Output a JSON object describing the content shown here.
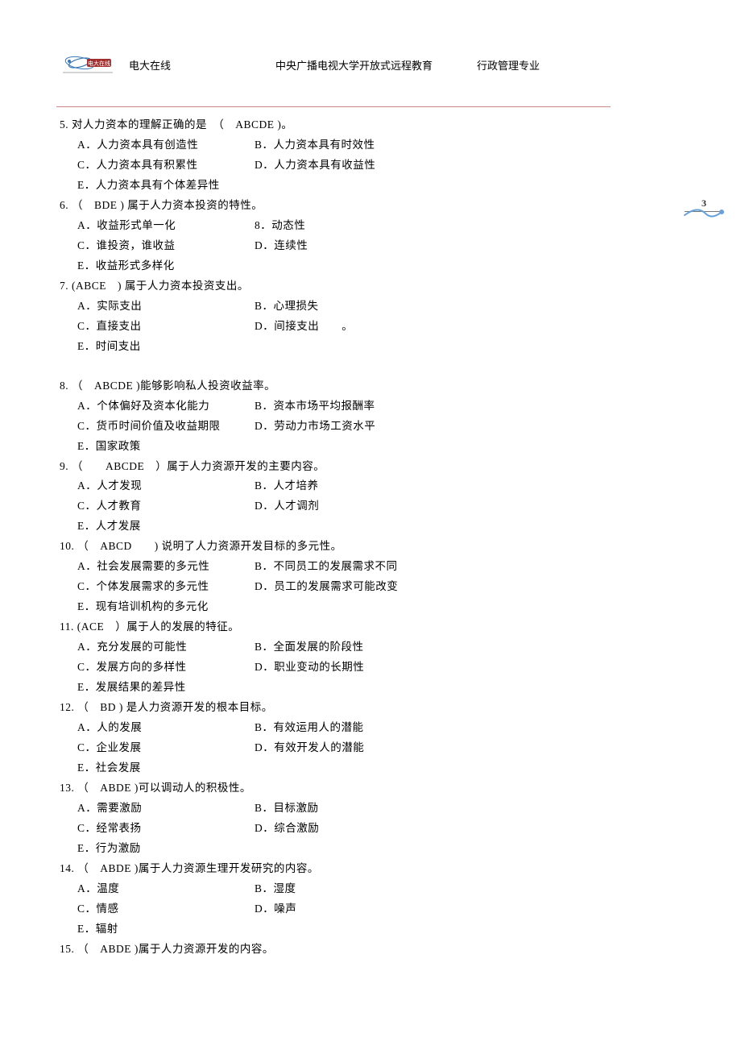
{
  "header": {
    "brand": "电大在线",
    "center": "中央广播电视大学开放式远程教育",
    "right": "行政管理专业"
  },
  "pageNumber": "3",
  "questions": [
    {
      "num": "5",
      "stemPrefix": "对人力资本的理解正确的是　（　",
      "answer": "ABCDE",
      "stemSuffix": " )。",
      "options": [
        [
          "A．人力资本具有创造性",
          "B．人力资本具有时效性"
        ],
        [
          "C．人力资本具有积累性",
          "D．人力资本具有收益性"
        ],
        [
          "E．人力资本具有个体差异性"
        ]
      ]
    },
    {
      "num": "6",
      "stemPrefix": "（　",
      "answer": "BDE",
      "stemSuffix": " ) 属于人力资本投资的特性。",
      "options": [
        [
          "A．收益形式单一化",
          "8．动态性"
        ],
        [
          "C．谁投资，谁收益",
          "D．连续性"
        ],
        [
          "E．收益形式多样化"
        ]
      ]
    },
    {
      "num": "7",
      "stemPrefix": "(",
      "answer": "ABCE",
      "stemSuffix": "　) 属于人力资本投资支出。",
      "options": [
        [
          "A．实际支出",
          "B．心理损失"
        ],
        [
          "C．直接支出",
          "D．间接支出　　。"
        ],
        [
          "E．时间支出"
        ]
      ],
      "trailingBlank": true
    },
    {
      "num": "8",
      "stemPrefix": "（　",
      "answer": "ABCDE",
      "stemSuffix": " )能够影响私人投资收益率。",
      "options": [
        [
          "A．个体偏好及资本化能力",
          "B．资本市场平均报酬率"
        ],
        [
          "C．货币时间价值及收益期限",
          "D．劳动力市场工资水平"
        ],
        [
          "E．国家政策"
        ]
      ]
    },
    {
      "num": "9",
      "stemPrefix": "（　　",
      "answer": "ABCDE",
      "stemSuffix": "　）属于人力资源开发的主要内容。",
      "options": [
        [
          "A．人才发现",
          "B．人才培养"
        ],
        [
          "C．人才教育",
          "D．人才调剂"
        ],
        [
          "E．人才发展"
        ]
      ]
    },
    {
      "num": "10",
      "stemPrefix": "（　",
      "answer": "ABCD",
      "stemSuffix": "　　) 说明了人力资源开发目标的多元性。",
      "options": [
        [
          "A．社会发展需要的多元性",
          "B．不同员工的发展需求不同"
        ],
        [
          "C．个体发展需求的多元性",
          "D．员工的发展需求可能改变"
        ],
        [
          "E．现有培训机构的多元化"
        ]
      ]
    },
    {
      "num": "11",
      "stemPrefix": "(",
      "answer": "ACE",
      "stemSuffix": "　）属于人的发展的特征。",
      "options": [
        [
          "A．充分发展的可能性",
          "B．全面发展的阶段性"
        ],
        [
          "C．发展方向的多样性",
          "D．职业变动的长期性"
        ],
        [
          "E．发展结果的差异性"
        ]
      ]
    },
    {
      "num": "12",
      "stemPrefix": "（　",
      "answer": "BD",
      "stemSuffix": " ) 是人力资源开发的根本目标。",
      "options": [
        [
          "A．人的发展",
          "B．有效运用人的潜能"
        ],
        [
          "C．企业发展",
          "D．有效开发人的潜能"
        ],
        [
          "E．社会发展"
        ]
      ]
    },
    {
      "num": "13",
      "stemPrefix": "（　",
      "answer": "ABDE",
      "stemSuffix": " )可以调动人的积极性。",
      "options": [
        [
          "A．需要激励",
          "B．目标激励"
        ],
        [
          "C．经常表扬",
          "D．综合激励"
        ],
        [
          "E．行为激励"
        ]
      ]
    },
    {
      "num": "14",
      "stemPrefix": "（　",
      "answer": "ABDE",
      "stemSuffix": " )属于人力资源生理开发研究的内容。",
      "options": [
        [
          "A．温度",
          "B．湿度"
        ],
        [
          "C．情感",
          "D．噪声"
        ],
        [
          "E．辐射"
        ]
      ]
    },
    {
      "num": "15",
      "stemPrefix": "（　",
      "answer": "ABDE",
      "stemSuffix": " )属于人力资源开发的内容。",
      "options": []
    }
  ]
}
